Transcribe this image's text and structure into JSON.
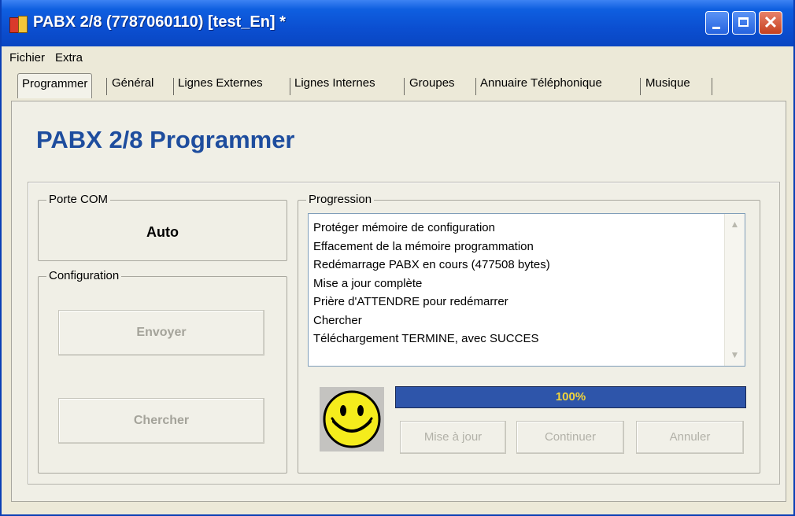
{
  "window": {
    "title": "PABX 2/8 (7787060110) [test_En] *"
  },
  "menu": {
    "items": [
      "Fichier",
      "Extra"
    ]
  },
  "tabs": [
    "Programmer",
    "Général",
    "Lignes Externes",
    "Lignes Internes",
    "Groupes",
    "Annuaire Téléphonique",
    "Musique"
  ],
  "page": {
    "title": "PABX 2/8 Programmer"
  },
  "com_port": {
    "legend": "Porte COM",
    "value": "Auto"
  },
  "configuration": {
    "legend": "Configuration",
    "send_label": "Envoyer",
    "search_label": "Chercher"
  },
  "progress": {
    "legend": "Progression",
    "log": [
      "Protéger mémoire de configuration",
      "Effacement de la mémoire programmation",
      "Redémarrage PABX en cours (477508 bytes)",
      "Mise a jour complète",
      "Prière d'ATTENDRE pour redémarrer",
      "Chercher",
      "Téléchargement TERMINE, avec SUCCES"
    ],
    "percent_label": "100%",
    "percent": 100,
    "buttons": {
      "update": "Mise à jour",
      "continue": "Continuer",
      "cancel": "Annuler"
    }
  }
}
